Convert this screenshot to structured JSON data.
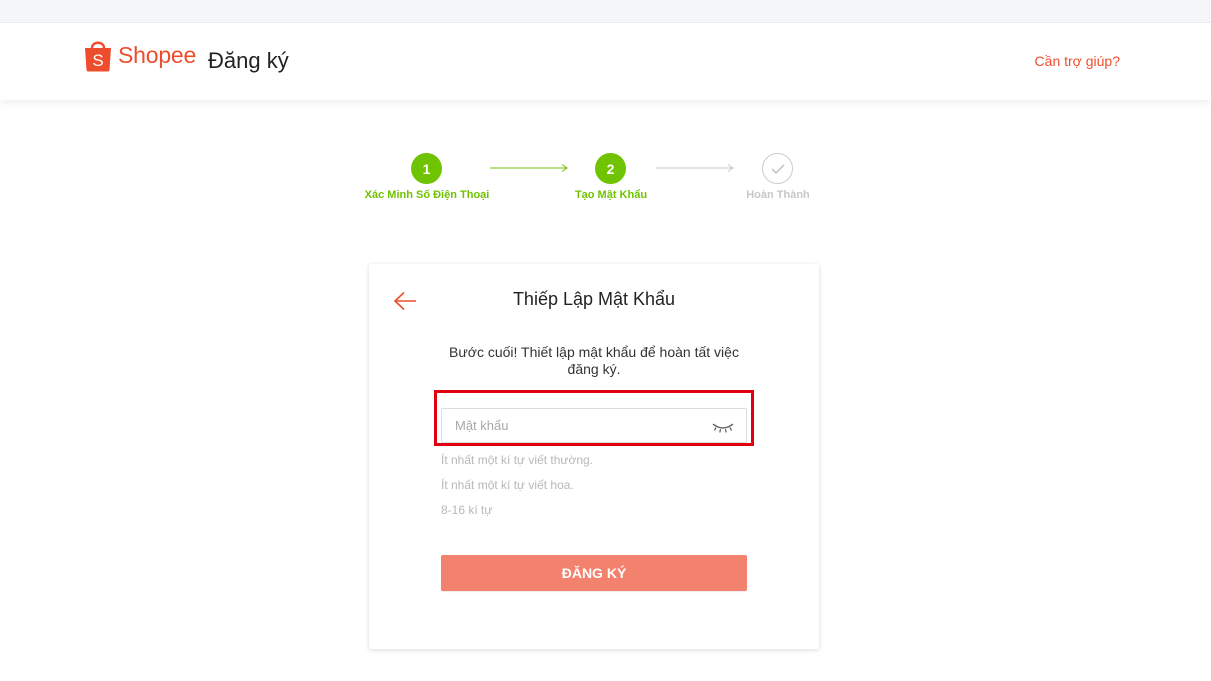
{
  "header": {
    "logo_text": "Shopee",
    "page_title": "Đăng ký",
    "help_link": "Cần trợ giúp?"
  },
  "stepper": {
    "steps": [
      {
        "number": "1",
        "label": "Xác Minh Số Điện Thoại",
        "state": "active"
      },
      {
        "number": "2",
        "label": "Tạo Mật Khẩu",
        "state": "active"
      },
      {
        "number": "",
        "label": "Hoàn Thành",
        "state": "pending",
        "icon": "check-icon"
      }
    ]
  },
  "card": {
    "title": "Thiếp Lập Mật Khẩu",
    "description": "Bước cuối! Thiết lập mật khẩu để hoàn tất việc đăng ký.",
    "password_placeholder": "Mật khẩu",
    "password_value": "",
    "rules": [
      "Ít nhất một kí tự viết thường.",
      "Ít nhất một kí tự viết hoa.",
      "8-16 kí tự"
    ],
    "submit_label": "ĐĂNG KÝ"
  },
  "colors": {
    "brand": "#ee4d2d",
    "step_active": "#6fc300",
    "button_disabled": "#f2826d",
    "highlight": "#e0000f"
  }
}
